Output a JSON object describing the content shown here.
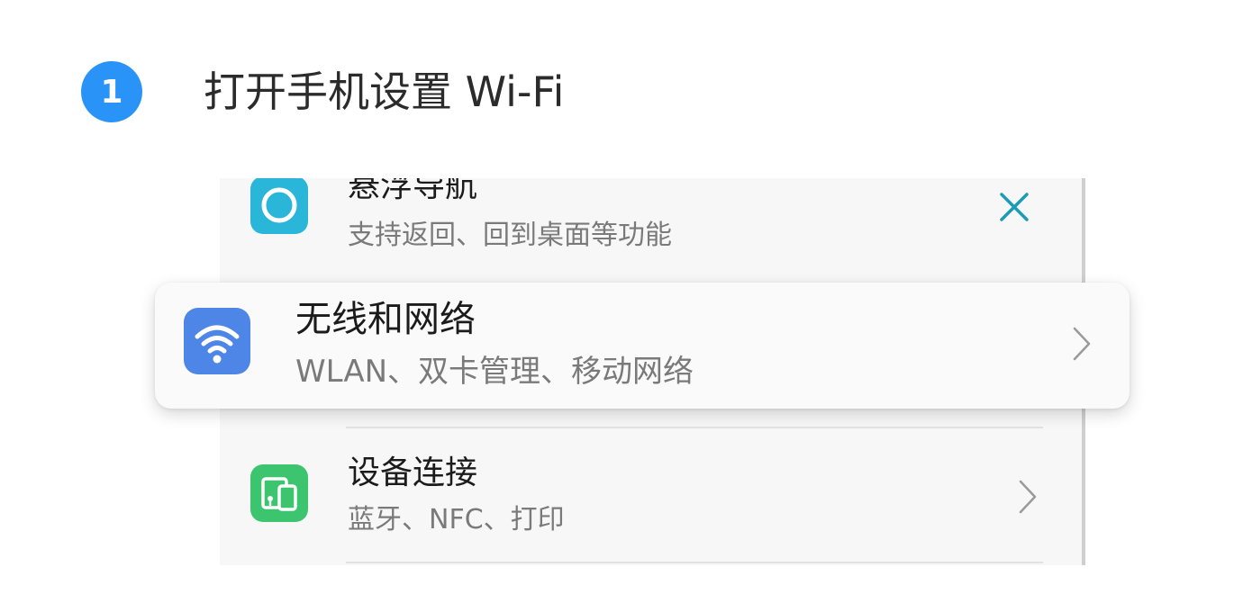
{
  "step": {
    "number": "1",
    "title": "打开手机设置 Wi-Fi"
  },
  "settings": {
    "items": [
      {
        "title": "悬浮导航",
        "subtitle": "支持返回、回到桌面等功能",
        "icon": "floating-nav-icon",
        "icon_color": "#2ab6d8",
        "trailing": "close-icon"
      },
      {
        "title": "无线和网络",
        "subtitle": "WLAN、双卡管理、移动网络",
        "icon": "wifi-icon",
        "icon_color": "#4d86e6",
        "trailing": "chevron-right-icon",
        "highlighted": true
      },
      {
        "title": "设备连接",
        "subtitle": "蓝牙、NFC、打印",
        "icon": "device-connection-icon",
        "icon_color": "#3cc46f",
        "trailing": "chevron-right-icon"
      }
    ]
  },
  "colors": {
    "badge": "#2a93f7",
    "close_icon": "#1b9bb5"
  }
}
